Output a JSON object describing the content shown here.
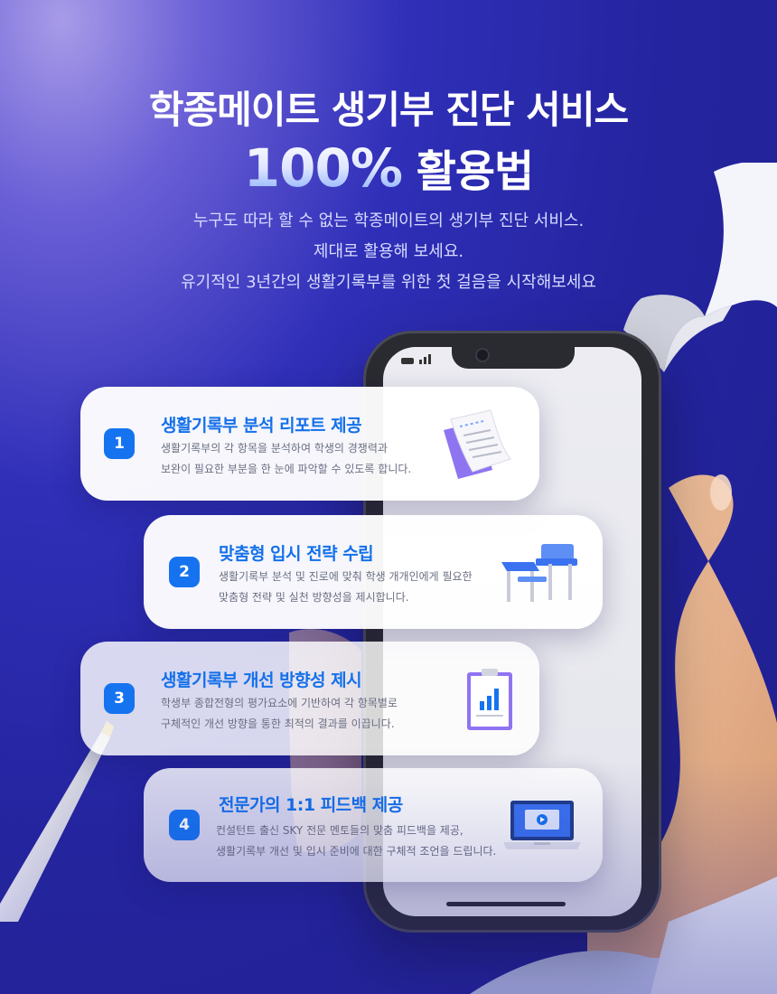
{
  "header": {
    "title_line1": "학종메이트 생기부 진단 서비스",
    "title_percent": "100%",
    "title_line2_rest": "활용법",
    "subtitle_lines": [
      "누구도 따라 할 수 없는 학종메이트의 생기부 진단 서비스.",
      "제대로 활용해 보세요.",
      "유기적인 3년간의 생활기록부를 위한 첫 걸음을 시작해보세요"
    ]
  },
  "features": [
    {
      "number": "1",
      "title": "생활기록부 분석 리포트 제공",
      "desc_lines": [
        "생활기록부의 각 항목을 분석하여 학생의 경쟁력과",
        "보완이 필요한 부분을 한 눈에 파악할 수 있도록 합니다."
      ],
      "icon": "report-document-icon"
    },
    {
      "number": "2",
      "title": "맞춤형 입시 전략 수립",
      "desc_lines": [
        "생활기록부 분석 및 진로에 맞춰 학생 개개인에게 필요한",
        "맞춤형 전략 및 실천 방향성을 제시합니다."
      ],
      "icon": "school-desk-icon"
    },
    {
      "number": "3",
      "title": "생활기록부 개선 방향성 제시",
      "desc_lines": [
        "학생부 종합전형의 평가요소에 기반하여 각 항목별로",
        "구체적인 개선 방향을 통한 최적의 결과를 이끕니다."
      ],
      "icon": "clipboard-chart-icon"
    },
    {
      "number": "4",
      "title": "전문가의 1:1 피드백 제공",
      "desc_lines": [
        "컨설턴트 출신 SKY 전문 멘토들의 맞춤 피드백을 제공,",
        "생활기록부 개선 및 입시 준비에 대한 구체적 조언을 드립니다."
      ],
      "icon": "laptop-video-icon"
    }
  ],
  "colors": {
    "accent": "#1470ea",
    "background": "#24249f"
  }
}
